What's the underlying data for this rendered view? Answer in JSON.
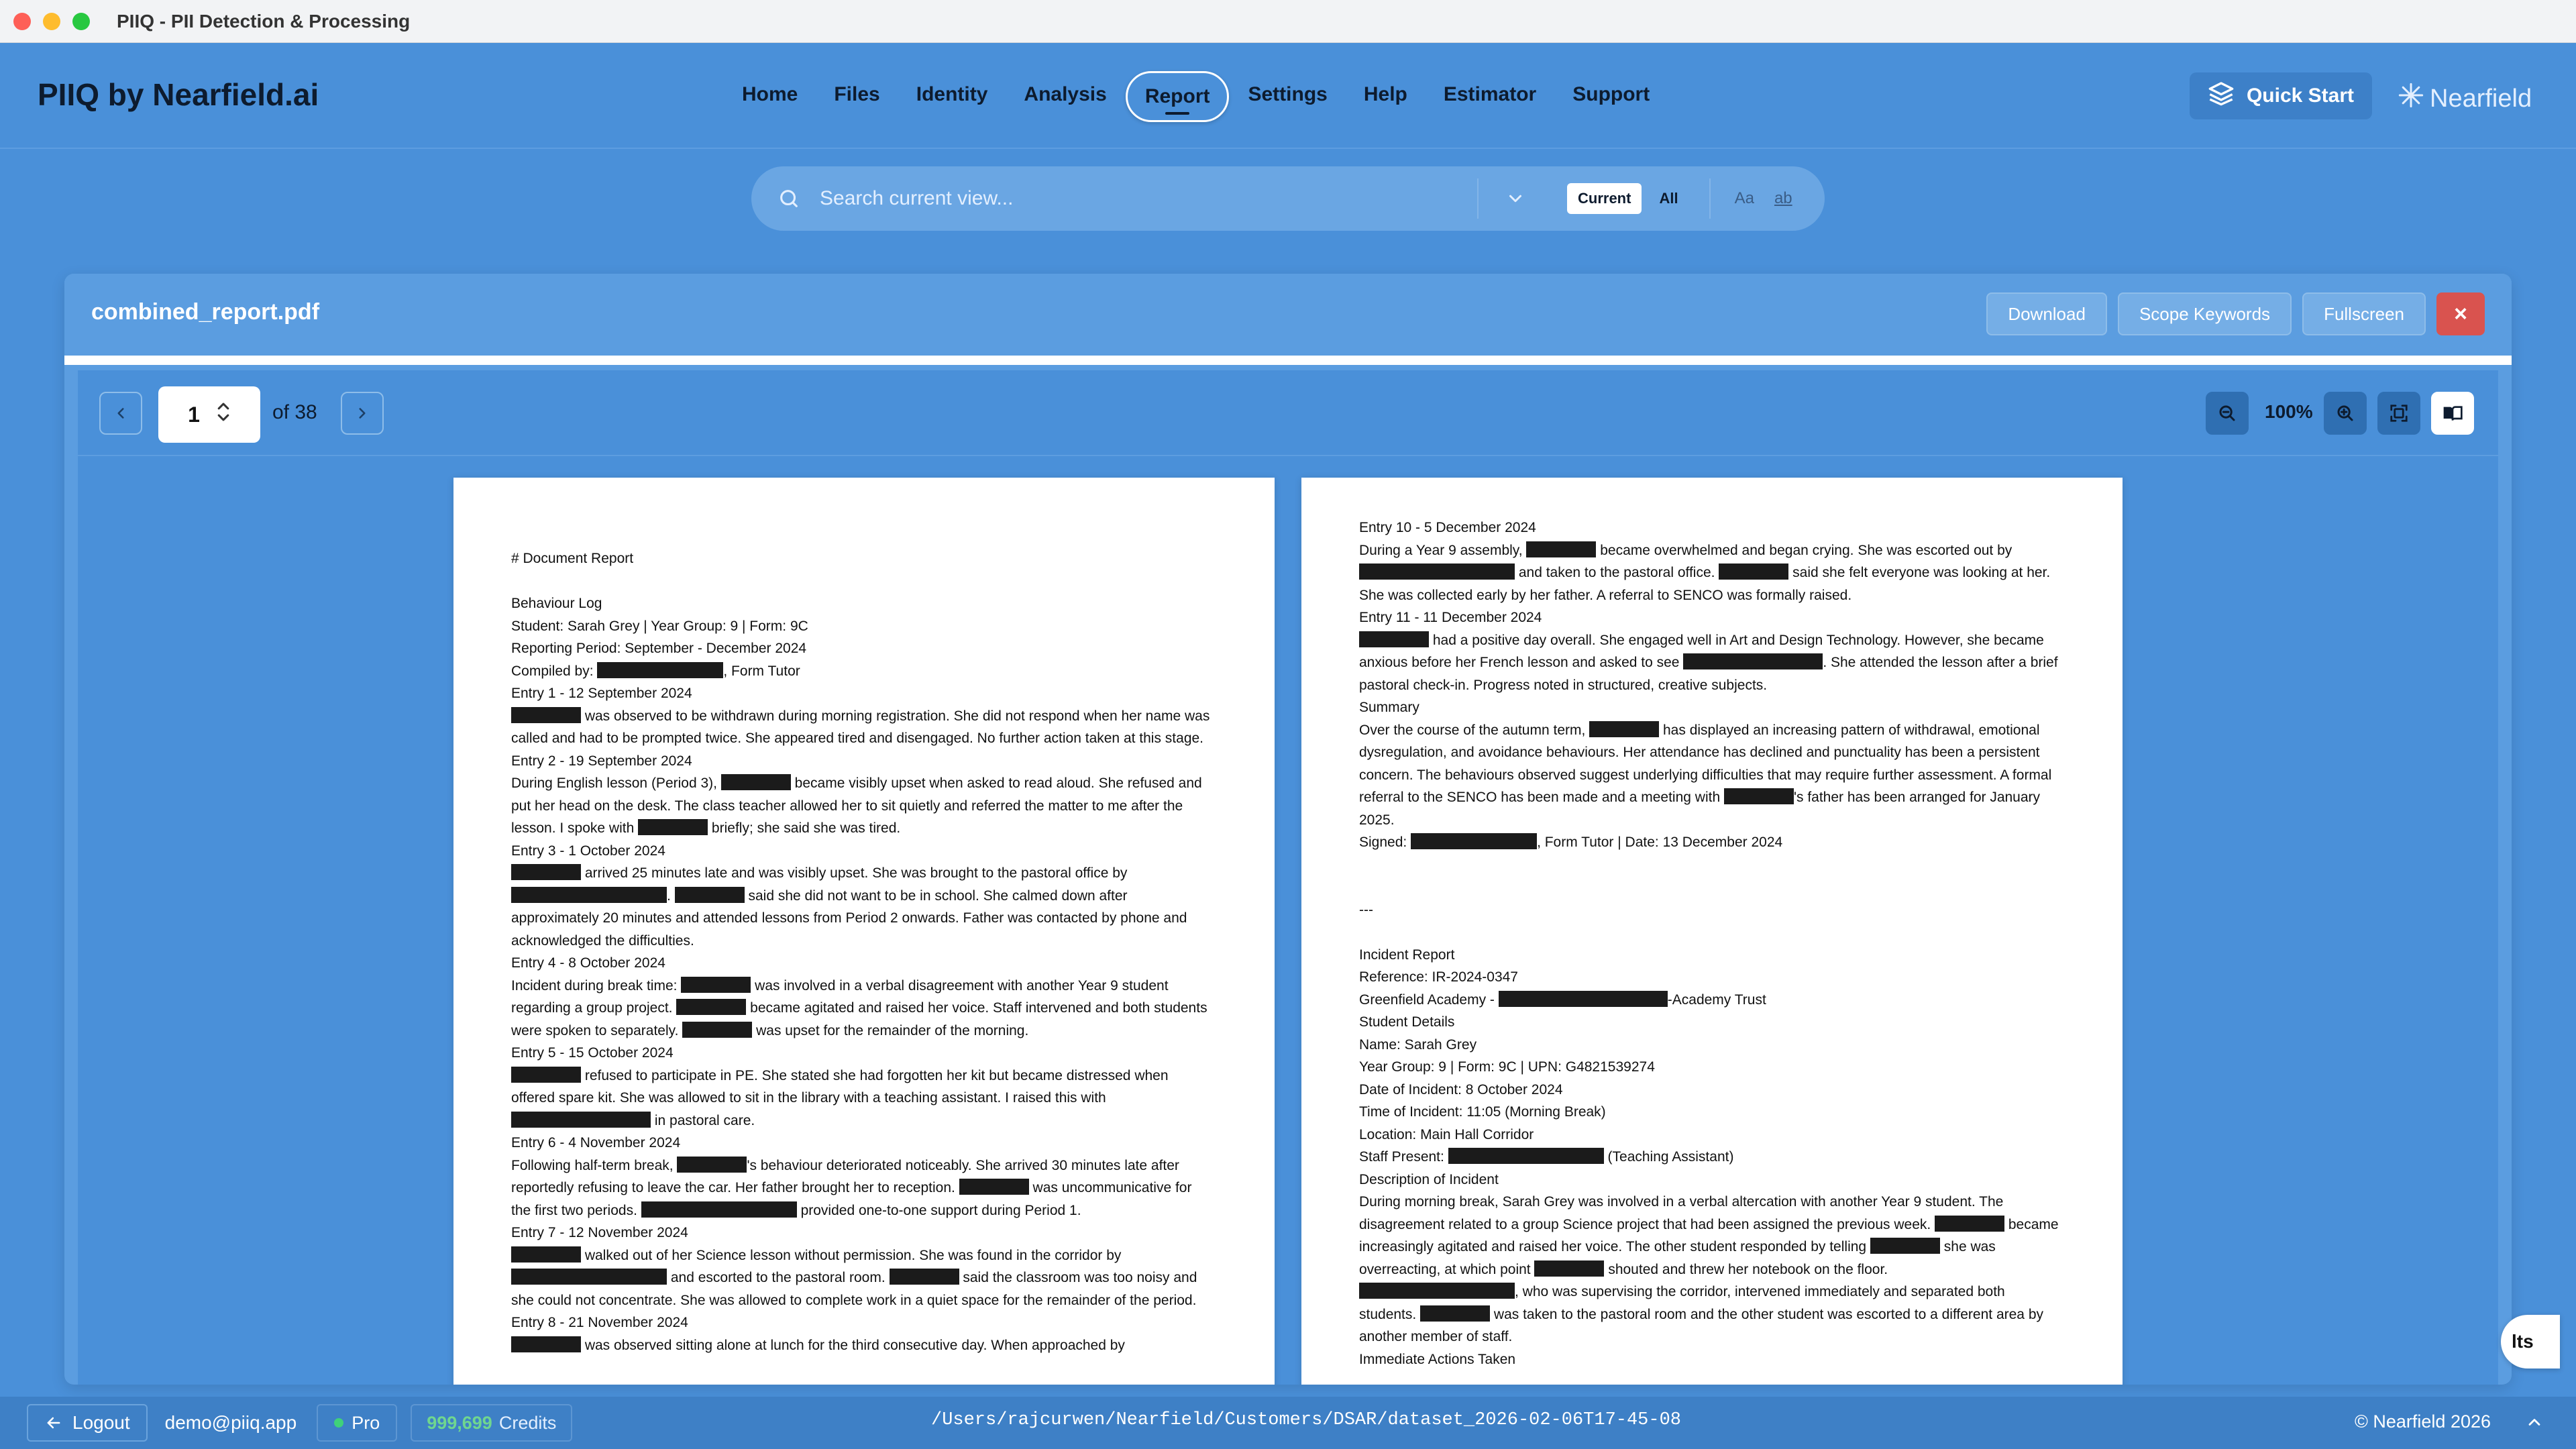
{
  "window": {
    "title": "PIIQ - PII Detection & Processing"
  },
  "brand": "PIIQ by Nearfield.ai",
  "nav": [
    {
      "label": "Home",
      "active": false
    },
    {
      "label": "Files",
      "active": false
    },
    {
      "label": "Identity",
      "active": false
    },
    {
      "label": "Analysis",
      "active": false
    },
    {
      "label": "Report",
      "active": true
    },
    {
      "label": "Settings",
      "active": false
    },
    {
      "label": "Help",
      "active": false
    },
    {
      "label": "Estimator",
      "active": false
    },
    {
      "label": "Support",
      "active": false
    }
  ],
  "quick_start": "Quick Start",
  "logo_text": "Nearfield",
  "search": {
    "placeholder": "Search current view...",
    "scope_current": "Current",
    "scope_all": "All",
    "match_case": "Aa",
    "whole_word": "ab"
  },
  "panel": {
    "filename": "combined_report.pdf",
    "download": "Download",
    "scope_keywords": "Scope Keywords",
    "fullscreen": "Fullscreen",
    "close": "×"
  },
  "viewer": {
    "page": "1",
    "of_pages": "of 38",
    "zoom": "100%"
  },
  "doc_left": {
    "title": "# Document Report",
    "l1": "Behaviour Log",
    "l2": "Student: Sarah Grey | Year Group: 9 | Form: 9C",
    "l3": "Reporting Period: September - December 2024",
    "l4a": "Compiled by: ",
    "l4b": ", Form Tutor",
    "e1": "Entry 1 - 12 September 2024",
    "e1a": " was observed to be withdrawn during morning registration. She did not respond when her name was",
    "e1b": "called and had to be prompted twice. She appeared tired and disengaged. No further action taken at this stage.",
    "e2": "Entry 2 - 19 September 2024",
    "e2a1": "During English lesson (Period 3), ",
    "e2a2": " became visibly upset when asked to read aloud. She refused and",
    "e2b": "put her head on the desk. The class teacher allowed her to sit quietly and referred the matter to me after the",
    "e2c1": "lesson. I spoke with ",
    "e2c2": " briefly; she said she was tired.",
    "e3": "Entry 3 - 1 October 2024",
    "e3a": " arrived 25 minutes late and was visibly upset. She was brought to the pastoral office by",
    "e3b1": ". ",
    "e3b2": " said she did not want to be in school. She calmed down after",
    "e3c": "approximately 20 minutes and attended lessons from Period 2 onwards. Father was contacted by phone and",
    "e3d": "acknowledged the difficulties.",
    "e4": "Entry 4 - 8 October 2024",
    "e4a1": "Incident during break time: ",
    "e4a2": " was involved in a verbal disagreement with another Year 9 student",
    "e4b1": "regarding a group project. ",
    "e4b2": " became agitated and raised her voice. Staff intervened and both students",
    "e4c1": "were spoken to separately. ",
    "e4c2": " was upset for the remainder of the morning.",
    "e5": "Entry 5 - 15 October 2024",
    "e5a": " refused to participate in PE. She stated she had forgotten her kit but became distressed when",
    "e5b": "offered spare kit. She was allowed to sit in the library with a teaching assistant. I raised this with",
    "e5c": " in pastoral care.",
    "e6": "Entry 6 - 4 November 2024",
    "e6a1": "Following half-term break, ",
    "e6a2": "'s behaviour deteriorated noticeably. She arrived 30 minutes late after",
    "e6b1": "reportedly refusing to leave the car. Her father brought her to reception. ",
    "e6b2": " was uncommunicative for",
    "e6c1": "the first two periods. ",
    "e6c2": " provided one-to-one support during Period 1.",
    "e7": "Entry 7 - 12 November 2024",
    "e7a": " walked out of her Science lesson without permission. She was found in the corridor by",
    "e7b1": " and escorted to the pastoral room. ",
    "e7b2": " said the classroom was too noisy and",
    "e7c": "she could not concentrate. She was allowed to complete work in a quiet space for the remainder of the period.",
    "e8": "Entry 8 - 21 November 2024",
    "e8a": " was observed sitting alone at lunch for the third consecutive day. When approached by"
  },
  "doc_right": {
    "e10": "Entry 10 - 5 December 2024",
    "e10a1": "During a Year 9 assembly, ",
    "e10a2": " became overwhelmed and began crying. She was escorted out by",
    "e10b1": " and taken to the pastoral office. ",
    "e10b2": " said she felt everyone was looking at her.",
    "e10c": "She was collected early by her father. A referral to SENCO was formally raised.",
    "e11": "Entry 11 - 11 December 2024",
    "e11a": " had a positive day overall. She engaged well in Art and Design Technology. However, she became",
    "e11b1": "anxious before her French lesson and asked to see ",
    "e11b2": ". She attended the lesson after a brief",
    "e11c": "pastoral check-in. Progress noted in structured, creative subjects.",
    "summary": "Summary",
    "s1a": "Over the course of the autumn term, ",
    "s1b": " has displayed an increasing pattern of withdrawal, emotional",
    "s2": "dysregulation, and avoidance behaviours. Her attendance has declined and punctuality has been a persistent",
    "s3": "concern. The behaviours observed suggest underlying difficulties that may require further assessment. A formal",
    "s4a": "referral to the SENCO has been made and a meeting with ",
    "s4b": "'s father has been arranged for January",
    "s5": "2025.",
    "signed_a": "Signed: ",
    "signed_b": ", Form Tutor | Date: 13 December 2024",
    "rule": "---",
    "ir": "Incident Report",
    "ref": "Reference: IR-2024-0347",
    "school_a": "Greenfield Academy - ",
    "school_b": "-Academy Trust",
    "sd": "Student Details",
    "name": "Name: Sarah Grey",
    "yg": "Year Group: 9 | Form: 9C | UPN: G4821539274",
    "doi": "Date of Incident: 8 October 2024",
    "toi": "Time of Incident: 11:05 (Morning Break)",
    "loc": "Location: Main Hall Corridor",
    "staff_a": "Staff Present: ",
    "staff_b": " (Teaching Assistant)",
    "doi2": "Description of Incident",
    "d1": "During morning break, Sarah Grey was involved in a verbal altercation with another Year 9 student. The",
    "d2a": "disagreement related to a group Science project that had been assigned the previous week. ",
    "d2b": " became",
    "d3a": "increasingly agitated and raised her voice. The other student responded by telling ",
    "d3b": " she was",
    "d4a": "overreacting, at which point ",
    "d4b": " shouted and threw her notebook on the floor.",
    "d5": ", who was supervising the corridor, intervened immediately and separated both",
    "d6a": "students. ",
    "d6b": " was taken to the pastoral room and the other student was escorted to a different area by",
    "d7": "another member of staff.",
    "iat": "Immediate Actions Taken"
  },
  "floating_chip": "lts",
  "footer": {
    "logout": "Logout",
    "email": "demo@piiq.app",
    "plan": "Pro",
    "credits_num": "999,699",
    "credits_label": "Credits",
    "path": "/Users/rajcurwen/Nearfield/Customers/DSAR/dataset_2026-02-06T17-45-08",
    "copyright": "© Nearfield 2026"
  },
  "colors": {
    "accent": "#4a90d9",
    "close": "#d9534f",
    "redaction": "#1b1b1b",
    "credits": "#6fd68f"
  }
}
